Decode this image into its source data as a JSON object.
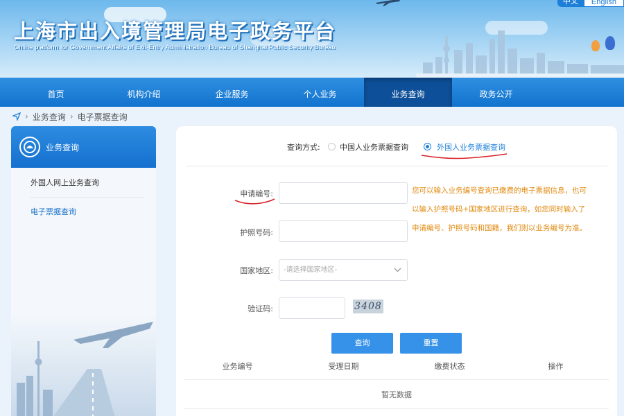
{
  "header": {
    "title": "上海市出入境管理局电子政务平台",
    "subtitle": "Online platform for Government Affairs of Exit-Entry Administration Bureau of Shanghai Public Security Bureau",
    "lang_zh": "中文",
    "lang_en": "English"
  },
  "nav": {
    "items": [
      {
        "label": "首页"
      },
      {
        "label": "机构介绍"
      },
      {
        "label": "企业服务"
      },
      {
        "label": "个人业务"
      },
      {
        "label": "业务查询"
      },
      {
        "label": "政务公开"
      }
    ],
    "active_index": 4
  },
  "breadcrumb": {
    "level1": "业务查询",
    "level2": "电子票据查询"
  },
  "sidebar": {
    "heading": "业务查询",
    "items": [
      {
        "label": "外国人网上业务查询"
      },
      {
        "label": "电子票据查询"
      }
    ]
  },
  "query": {
    "label": "查询方式:",
    "option_chinese": "中国人业务票据查询",
    "option_foreign": "外国人业务票据查询",
    "selected": "外国人业务票据查询"
  },
  "form": {
    "app_no_label": "申请编号:",
    "app_no_value": "",
    "passport_label": "护照号码:",
    "passport_value": "",
    "country_label": "国家地区:",
    "country_placeholder": "-请选择国家地区-",
    "captcha_label": "验证码:",
    "captcha_value": "",
    "captcha_image_text": "3408"
  },
  "hint": {
    "line1": "您可以输入业务编号查询已缴费的电子票据信息，也可",
    "line2": "以输入护照号码+国家地区进行查询，如您同时输入了",
    "line3": "申请编号、护照号码和国籍，我们则以业务编号为准。"
  },
  "buttons": {
    "search": "查询",
    "reset": "重置"
  },
  "table": {
    "columns": [
      "业务编号",
      "受理日期",
      "缴费状态",
      "操作"
    ],
    "empty_text": "暂无数据"
  },
  "colors": {
    "brand_blue": "#1e7fd8",
    "nav_active": "#0d4f98",
    "hint_orange": "#e08a10",
    "annotation_red": "#d8222a"
  }
}
